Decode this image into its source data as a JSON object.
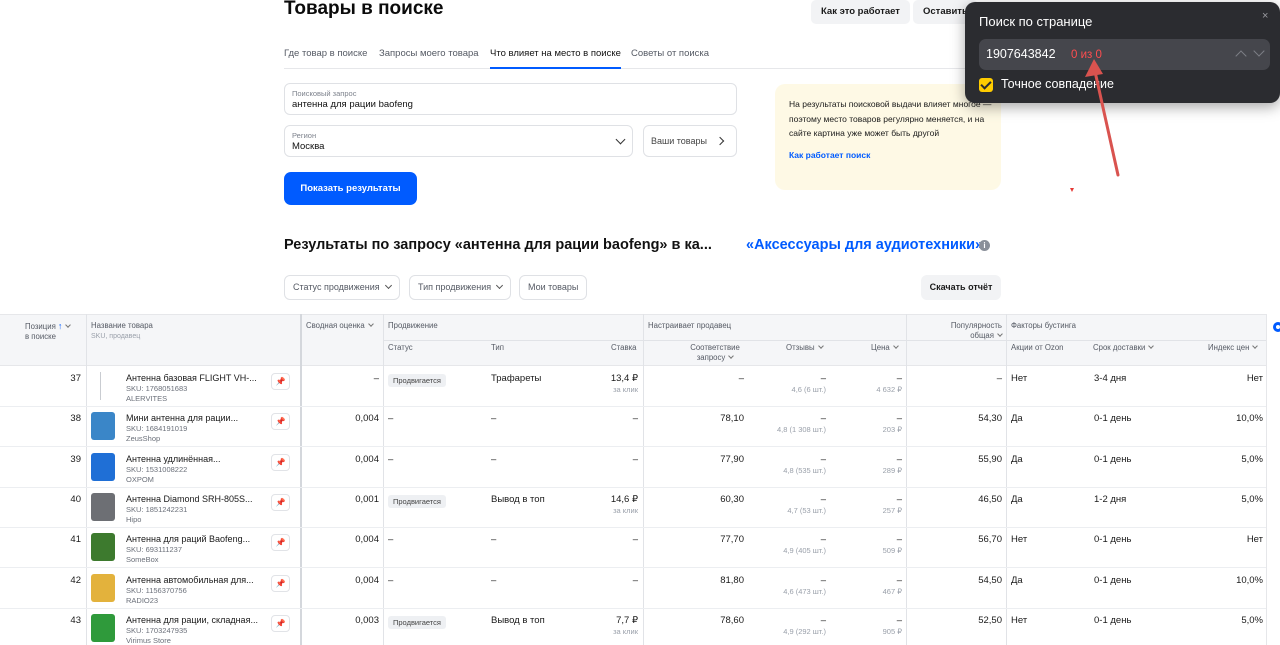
{
  "header": {
    "title": "Товары в поиске",
    "how_it_works": "Как это работает",
    "leave_feedback": "Оставить"
  },
  "tabs": [
    {
      "label": "Где товар в поиске"
    },
    {
      "label": "Запросы моего товара"
    },
    {
      "label": "Что влияет на место в поиске",
      "active": true
    },
    {
      "label": "Советы от поиска"
    }
  ],
  "form": {
    "query_label": "Поисковый запрос",
    "query_value": "антенна для рации baofeng",
    "region_label": "Регион",
    "region_value": "Москва",
    "your_products": "Ваши товары",
    "submit": "Показать результаты"
  },
  "info": {
    "text": "На результаты поисковой выдачи влияет многое — поэтому место товаров регулярно меняется, и на сайте картина уже может быть другой",
    "link": "Как работает поиск"
  },
  "results": {
    "title": "Результаты по запросу «антенна для рации baofeng» в ка...",
    "category": "«Аксессуары для аудиотехники»",
    "info_icon": "i"
  },
  "filters": {
    "promo_status": "Статус продвижения",
    "promo_type": "Тип продвижения",
    "my_products": "Мои товары",
    "download": "Скачать отчёт"
  },
  "table": {
    "headers": {
      "position": "Позиция",
      "position_sub": "в поиске",
      "name": "Название товара",
      "name_sub": "SKU, продавец",
      "score": "Сводная оценка",
      "promotion": "Продвижение",
      "status": "Статус",
      "type": "Тип",
      "bid": "Ставка",
      "seller": "Настраивает продавец",
      "relevance": "Соответствие запросу",
      "reviews": "Отзывы",
      "price": "Цена",
      "popularity": "Популярность общая",
      "boost": "Факторы бустинга",
      "ozon_promo": "Акции от Ozon",
      "delivery": "Срок доставки",
      "price_index": "Индекс цен"
    },
    "rows": [
      {
        "pos": "37",
        "name": "Антенна базовая FLIGHT VH-...",
        "sku": "SKU: 1768051683",
        "shop": "ALERVITES",
        "score": "–",
        "status": "Продвигается",
        "type": "Трафареты",
        "bid": "13,4 ₽",
        "bid_sub": "за клик",
        "rel": "–",
        "reviews": "–",
        "reviews_sub": "4,6 (6 шт.)",
        "price": "–",
        "price_sub": "4 632 ₽",
        "pop": "–",
        "promo": "Нет",
        "delivery": "3-4 дня",
        "index": "Нет",
        "thumb": "none"
      },
      {
        "pos": "38",
        "name": "Мини антенна для рации...",
        "sku": "SKU: 1684191019",
        "shop": "ZeusShop",
        "score": "0,004",
        "status": "–",
        "type": "–",
        "bid": "–",
        "bid_sub": "",
        "rel": "78,10",
        "reviews": "–",
        "reviews_sub": "4,8 (1 308 шт.)",
        "price": "–",
        "price_sub": "203 ₽",
        "pop": "54,30",
        "promo": "Да",
        "delivery": "0-1 день",
        "index": "10,0%",
        "thumb": "#3a86c8"
      },
      {
        "pos": "39",
        "name": "Антенна удлинённая...",
        "sku": "SKU: 1531008222",
        "shop": "OXPOM",
        "score": "0,004",
        "status": "–",
        "type": "–",
        "bid": "–",
        "bid_sub": "",
        "rel": "77,90",
        "reviews": "–",
        "reviews_sub": "4,8 (535 шт.)",
        "price": "–",
        "price_sub": "289 ₽",
        "pop": "55,90",
        "promo": "Да",
        "delivery": "0-1 день",
        "index": "5,0%",
        "thumb": "#1f6fd6"
      },
      {
        "pos": "40",
        "name": "Антенна Diamond SRH-805S...",
        "sku": "SKU: 1851242231",
        "shop": "Hipo",
        "score": "0,001",
        "status": "Продвигается",
        "type": "Вывод в топ",
        "bid": "14,6 ₽",
        "bid_sub": "за клик",
        "rel": "60,30",
        "reviews": "–",
        "reviews_sub": "4,7 (53 шт.)",
        "price": "–",
        "price_sub": "257 ₽",
        "pop": "46,50",
        "promo": "Да",
        "delivery": "1-2 дня",
        "index": "5,0%",
        "thumb": "#6d6f74"
      },
      {
        "pos": "41",
        "name": "Антенна для раций Baofeng...",
        "sku": "SKU: 693111237",
        "shop": "SomeBox",
        "score": "0,004",
        "status": "–",
        "type": "–",
        "bid": "–",
        "bid_sub": "",
        "rel": "77,70",
        "reviews": "–",
        "reviews_sub": "4,9 (405 шт.)",
        "price": "–",
        "price_sub": "509 ₽",
        "pop": "56,70",
        "promo": "Нет",
        "delivery": "0-1 день",
        "index": "Нет",
        "thumb": "#3d7a2e"
      },
      {
        "pos": "42",
        "name": "Антенна автомобильная для...",
        "sku": "SKU: 1156370756",
        "shop": "RADIO23",
        "score": "0,004",
        "status": "–",
        "type": "–",
        "bid": "–",
        "bid_sub": "",
        "rel": "81,80",
        "reviews": "–",
        "reviews_sub": "4,6 (473 шт.)",
        "price": "–",
        "price_sub": "467 ₽",
        "pop": "54,50",
        "promo": "Да",
        "delivery": "0-1 день",
        "index": "10,0%",
        "thumb": "#e3b23c"
      },
      {
        "pos": "43",
        "name": "Антенна для рации, складная...",
        "sku": "SKU: 1703247935",
        "shop": "Virimus Store",
        "score": "0,003",
        "status": "Продвигается",
        "type": "Вывод в топ",
        "bid": "7,7 ₽",
        "bid_sub": "за клик",
        "rel": "78,60",
        "reviews": "–",
        "reviews_sub": "4,9 (292 шт.)",
        "price": "–",
        "price_sub": "905 ₽",
        "pop": "52,50",
        "promo": "Нет",
        "delivery": "0-1 день",
        "index": "5,0%",
        "thumb": "#2f9a3b"
      }
    ]
  },
  "find_panel": {
    "title": "Поиск по странице",
    "close": "×",
    "value": "1907643842",
    "count": "0 из 0",
    "exact": "Точное совпадение"
  },
  "colors": {
    "accent": "#005bff",
    "info_bg": "#fef9e5",
    "find_bg": "#2b2c30",
    "find_count": "#ff4d4f",
    "checkbox": "#ffcc00"
  }
}
